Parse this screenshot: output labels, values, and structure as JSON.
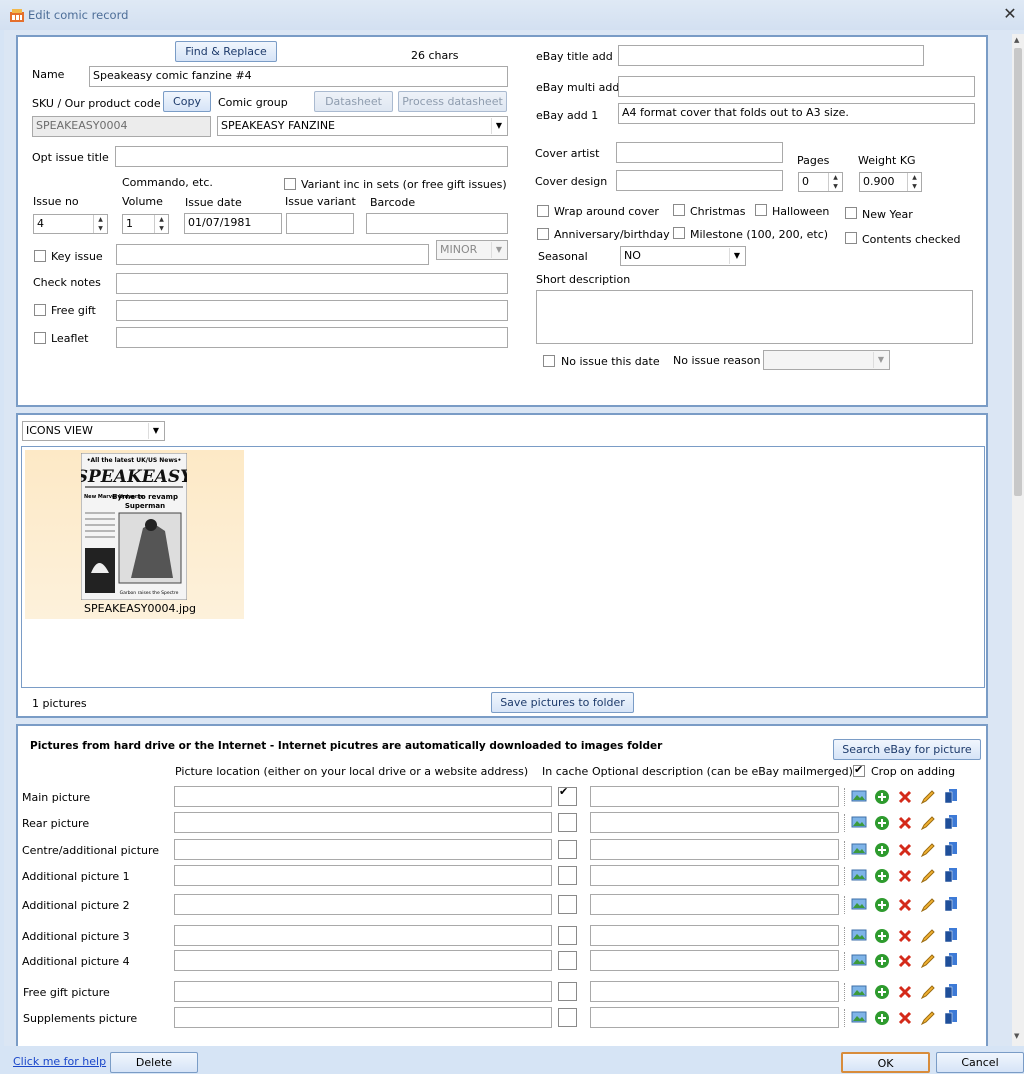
{
  "window": {
    "title": "Edit comic record",
    "close": "✕"
  },
  "main": {
    "find_replace": "Find & Replace",
    "char_count": "26 chars",
    "name_label": "Name",
    "name_value": "Speakeasy comic fanzine #4",
    "sku_label": "SKU / Our product code",
    "copy": "Copy",
    "comic_group_label": "Comic group",
    "datasheet": "Datasheet",
    "process_datasheet": "Process datasheet",
    "sku_value": "SPEAKEASY0004",
    "comic_group_value": "SPEAKEASY FANZINE",
    "opt_issue_title_label": "Opt issue title",
    "commando_label": "Commando, etc.",
    "variant_label": "Variant inc in sets (or free gift issues)",
    "issue_no_label": "Issue no",
    "volume_label": "Volume",
    "issue_date_label": "Issue date",
    "issue_variant_label": "Issue variant",
    "barcode_label": "Barcode",
    "issue_no_value": "4",
    "volume_value": "1",
    "issue_date_value": "01/07/1981",
    "key_issue_label": "Key issue",
    "minor_value": "MINOR",
    "check_notes_label": "Check notes",
    "free_gift_label": "Free gift",
    "leaflet_label": "Leaflet"
  },
  "ebay": {
    "title_add_label": "eBay title add",
    "multi_add_label": "eBay multi add",
    "add1_label": "eBay add 1",
    "add1_value": "A4 format cover that folds out to A3 size.",
    "cover_artist_label": "Cover artist",
    "cover_design_label": "Cover design",
    "pages_label": "Pages",
    "weight_label": "Weight KG",
    "pages_value": "0",
    "weight_value": "0.900",
    "wrap_label": "Wrap around cover",
    "christmas_label": "Christmas",
    "halloween_label": "Halloween",
    "new_year_label": "New Year",
    "anniversary_label": "Anniversary/birthday",
    "milestone_label": "Milestone (100, 200, etc)",
    "contents_checked_label": "Contents checked",
    "seasonal_label": "Seasonal",
    "seasonal_value": "NO",
    "short_desc_label": "Short description",
    "no_issue_date_label": "No issue this date",
    "no_issue_reason_label": "No issue reason"
  },
  "icons_view": {
    "view_value": "ICONS VIEW",
    "thumb_caption": "SPEAKEASY0004.jpg",
    "cover_lines": [
      "•All the latest UK/US News•",
      "SPEAKEASY",
      "Byrne to revamp",
      "Superman",
      "New Marvel Universe",
      "Garbon raises the Spectre"
    ],
    "pictures_count": "1 pictures",
    "save_to_folder": "Save pictures to folder"
  },
  "pictures": {
    "heading": "Pictures from hard drive or the Internet - Internet picutres are automatically downloaded to images folder",
    "search_ebay": "Search eBay for picture",
    "col_location": "Picture location (either on your local drive or a website address)",
    "col_cache": "In cache",
    "col_desc": "Optional description (can be eBay mailmerged)",
    "crop_label": "Crop on adding",
    "rows": [
      {
        "label": "Main picture",
        "cached": true
      },
      {
        "label": "Rear picture",
        "cached": false
      },
      {
        "label": "Centre/additional picture",
        "cached": false
      },
      {
        "label": "Additional picture 1",
        "cached": false
      },
      {
        "label": "Additional picture 2",
        "cached": false
      },
      {
        "label": "Additional picture 3",
        "cached": false
      },
      {
        "label": "Additional picture 4",
        "cached": false
      },
      {
        "label": "Free gift picture",
        "cached": false
      },
      {
        "label": "Supplements picture",
        "cached": false
      }
    ]
  },
  "footer": {
    "help": "Click me for help",
    "delete": "Delete",
    "ok": "OK",
    "cancel": "Cancel"
  },
  "colors": {
    "accent": "#7a9cc6",
    "tile": "#fde9c6",
    "ok_border": "#d88c3b",
    "green": "#2e9b2e",
    "red": "#d42a1a"
  }
}
